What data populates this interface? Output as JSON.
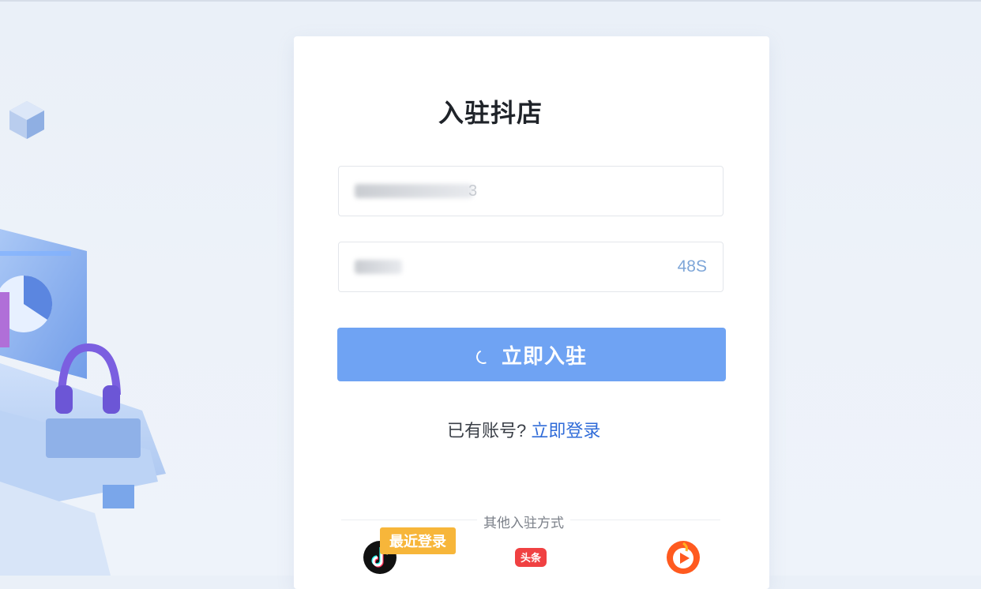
{
  "page": {
    "title": "入驻抖店"
  },
  "form": {
    "phone_tail": "3",
    "countdown": "48S",
    "submit_label": "立即入驻"
  },
  "login_prompt": {
    "text": "已有账号?",
    "link": "立即登录"
  },
  "other_methods": {
    "label": "其他入驻方式",
    "recent_badge": "最近登录",
    "icons": [
      "douyin-icon",
      "toutiao-icon",
      "huoshan-icon"
    ],
    "toutiao_text": "头条"
  },
  "colors": {
    "accent": "#6fa3f3",
    "link": "#2f6bd8",
    "badge": "#f7b63a"
  }
}
